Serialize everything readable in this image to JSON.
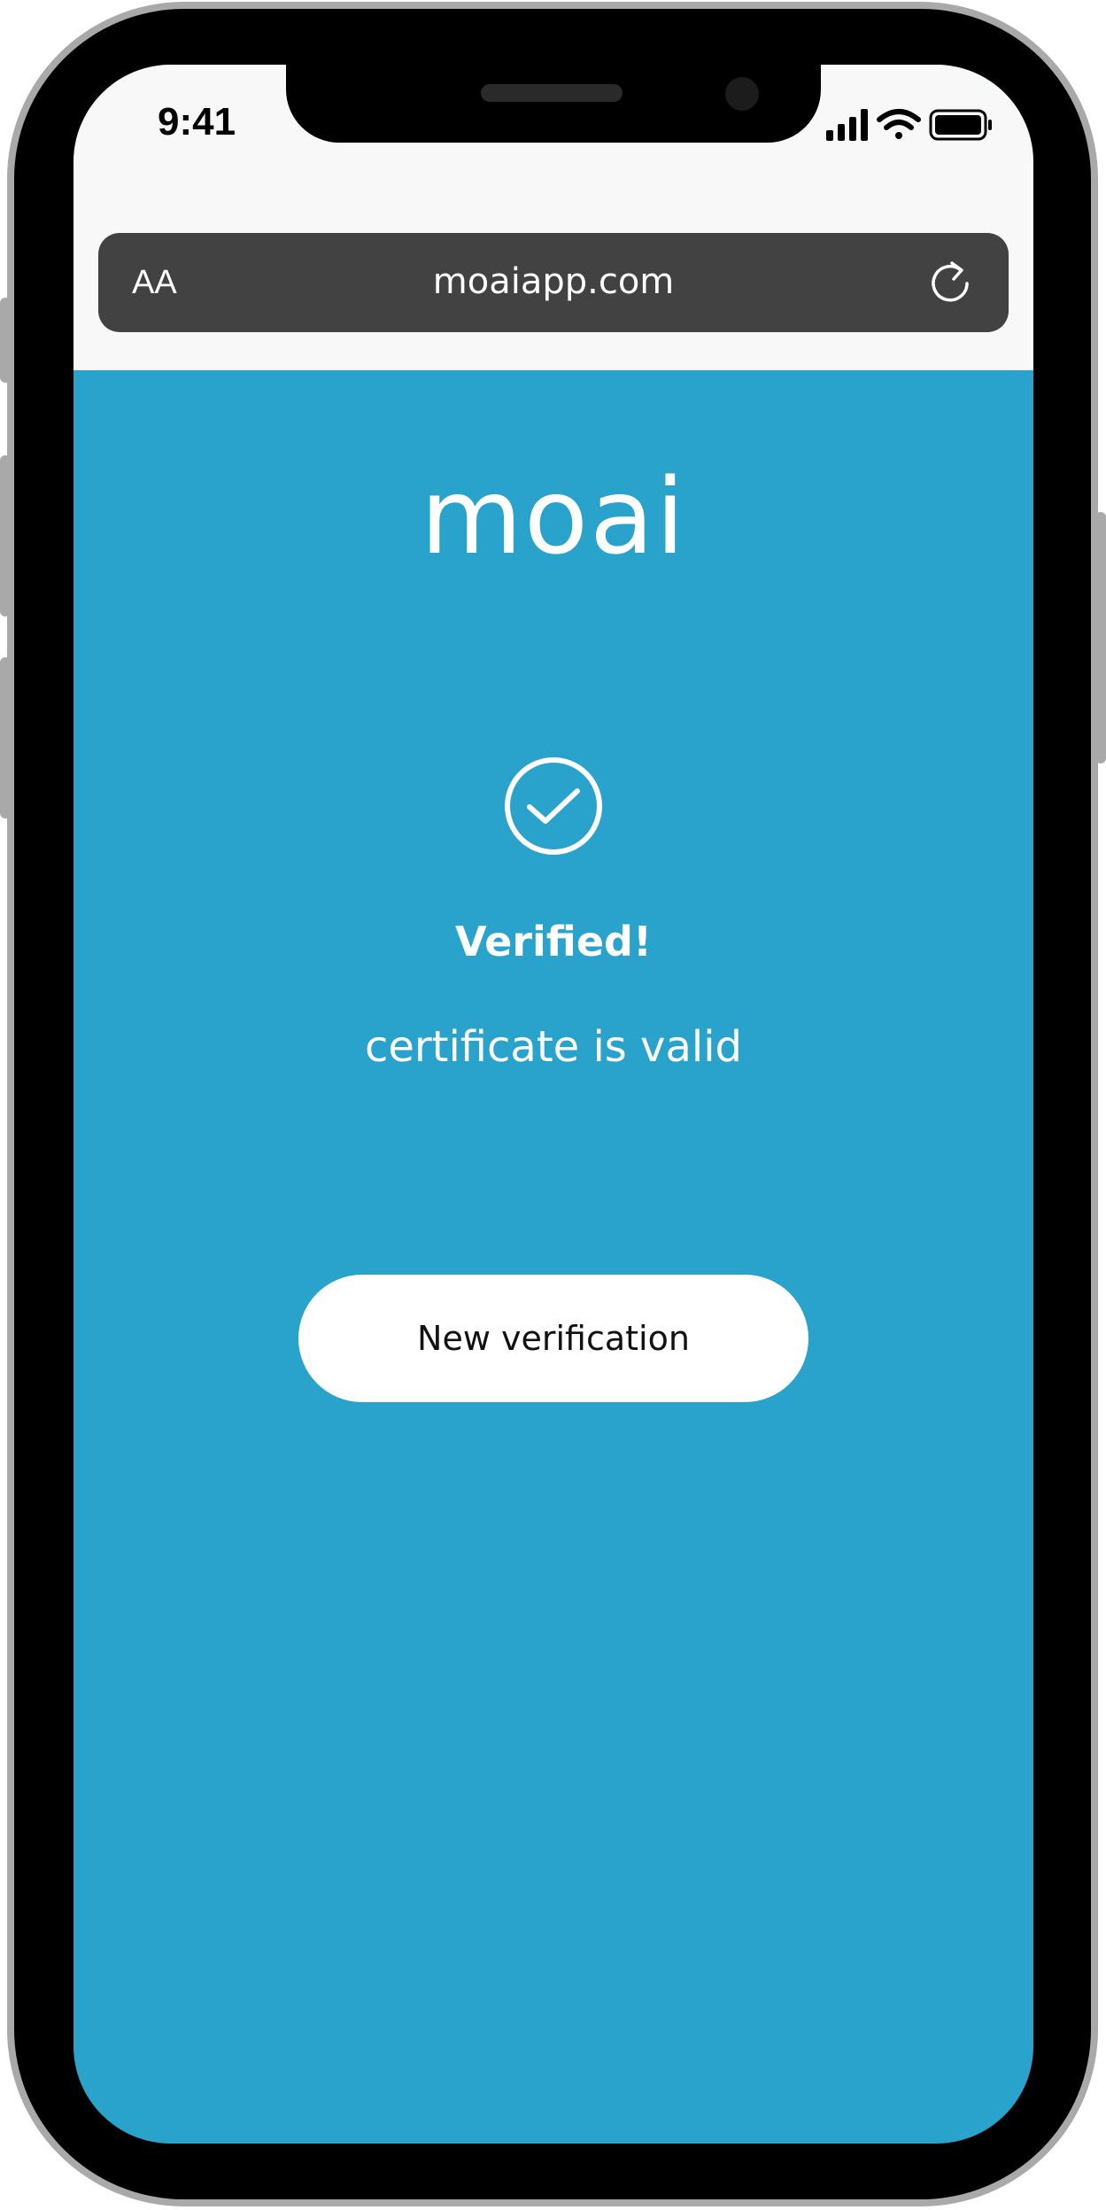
{
  "status_bar": {
    "time": "9:41",
    "icons": [
      "signal-icon",
      "wifi-icon",
      "battery-icon"
    ]
  },
  "browser": {
    "text_size_label": "AA",
    "url": "moaiapp.com",
    "reload_icon": "reload-icon"
  },
  "app": {
    "logo": "moai",
    "status_icon": "check-circle-icon",
    "title": "Verified!",
    "subtitle": "certificate is valid",
    "new_verification_label": "New verification"
  },
  "colors": {
    "background": "#29a3cb",
    "address_bar": "#424242",
    "status_area": "#f8f8f8",
    "button": "#ffffff"
  }
}
